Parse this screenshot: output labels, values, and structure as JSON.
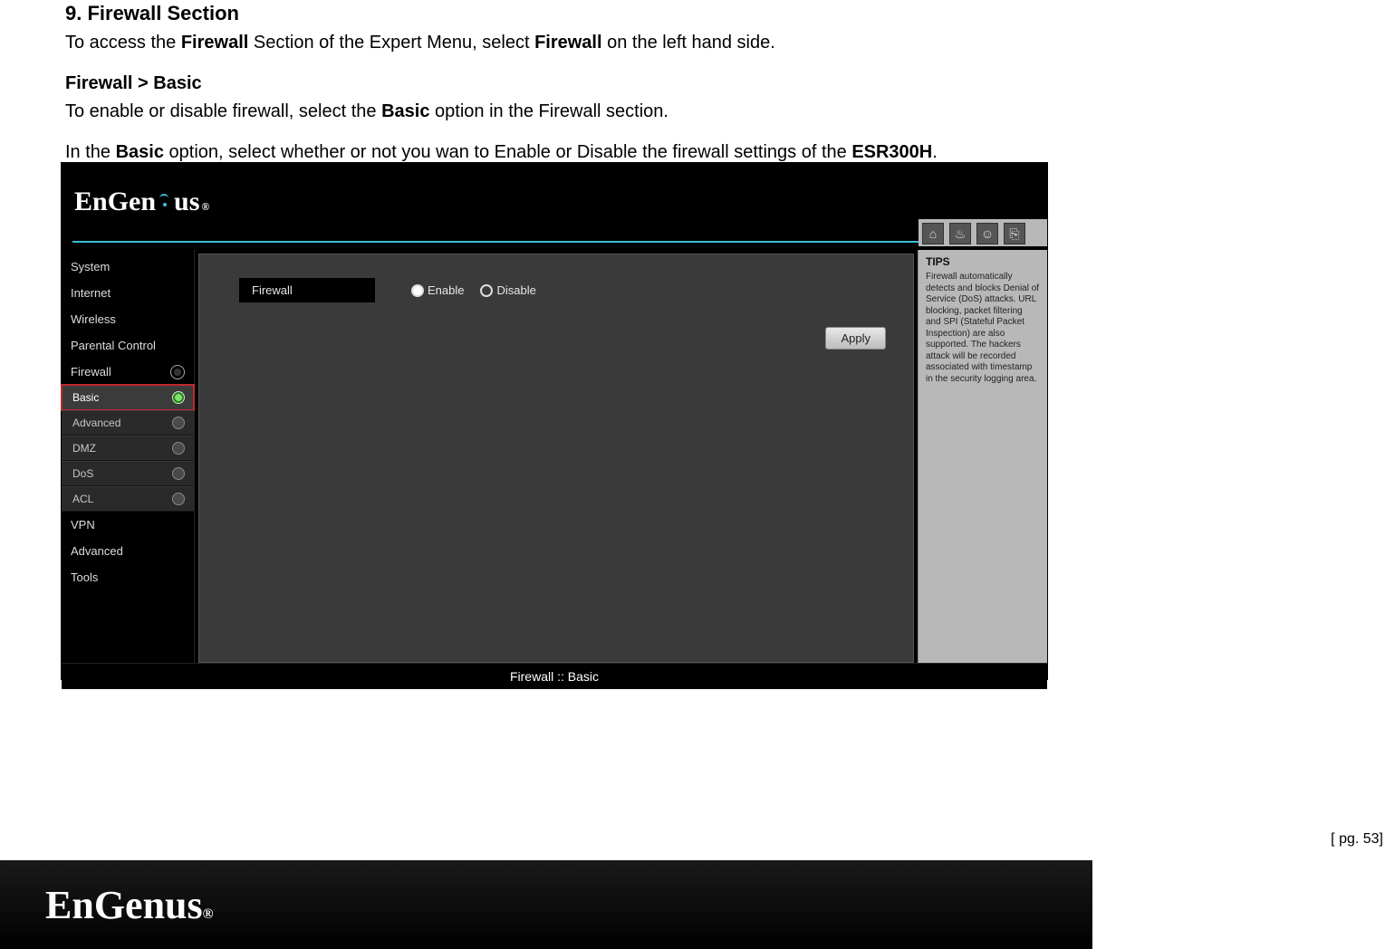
{
  "doc": {
    "heading": "9.  Firewall Section",
    "p1_a": "To access the ",
    "p1_b1": "Firewall",
    "p1_c": " Section of the Expert Menu, select ",
    "p1_b2": "Firewall",
    "p1_d": " on the left hand side.",
    "sub1": "Firewall > Basic",
    "p2_a": "To enable or disable firewall, select the ",
    "p2_b": "Basic",
    "p2_c": " option in the Firewall section.",
    "p3_a": "In the ",
    "p3_b1": "Basic",
    "p3_c": " option, select whether or not you wan to Enable or Disable the firewall settings of the ",
    "p3_b2": "ESR300H",
    "p3_d": "."
  },
  "brand": {
    "prefix": "EnGen",
    "suffix": "us",
    "reg": "®"
  },
  "nav": {
    "items": [
      "System",
      "Internet",
      "Wireless",
      "Parental Control",
      "Firewall",
      "VPN",
      "Advanced",
      "Tools"
    ],
    "firewall_sub": [
      "Basic",
      "Advanced",
      "DMZ",
      "DoS",
      "ACL"
    ]
  },
  "form": {
    "label": "Firewall",
    "enable": "Enable",
    "disable": "Disable",
    "apply": "Apply"
  },
  "tips": {
    "title": "TIPS",
    "body": "Firewall automatically detects and blocks Denial of Service (DoS) attacks. URL blocking, packet filtering and SPI (Stateful Packet Inspection) are also supported. The hackers attack will be recorded associated with timestamp in the security logging area."
  },
  "breadcrumb": "Firewall :: Basic",
  "page_number": "[ pg. 53]"
}
